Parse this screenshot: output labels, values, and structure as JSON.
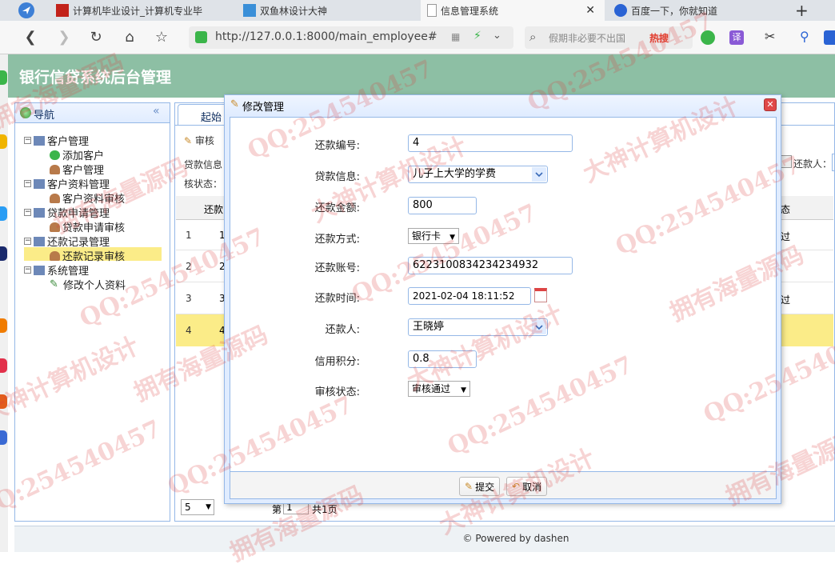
{
  "browser": {
    "tabs": [
      {
        "title": "计算机毕业设计_计算机专业毕"
      },
      {
        "title": "双鱼林设计大神"
      },
      {
        "title": "信息管理系统"
      },
      {
        "title": "百度一下，你就知道"
      }
    ],
    "url": "http://127.0.0.1:8000/main_employee#",
    "search_placeholder": "假期非必要不出国",
    "hot_label": "热搜",
    "translate_label": "译"
  },
  "app": {
    "title": "银行信贷系统后台管理",
    "nav_title": "导航",
    "tree": [
      {
        "label": "客户管理",
        "level": 0
      },
      {
        "label": "添加客户",
        "level": 1
      },
      {
        "label": "客户管理",
        "level": 1
      },
      {
        "label": "客户资料管理",
        "level": 0
      },
      {
        "label": "客户资料审核",
        "level": 1
      },
      {
        "label": "贷款申请管理",
        "level": 0
      },
      {
        "label": "贷款申请审核",
        "level": 1
      },
      {
        "label": "还款记录管理",
        "level": 0
      },
      {
        "label": "还款记录审核",
        "level": 1
      },
      {
        "label": "系统管理",
        "level": 0
      },
      {
        "label": "修改个人资料",
        "level": 1
      }
    ],
    "main": {
      "tab_label": "起始",
      "toolbar_review": "审核",
      "filter_loan_info": "贷款信息",
      "filter_status": "核状态：",
      "filter_payer": "还款人：",
      "col_header": "还款",
      "col_status": "态",
      "rows": [
        "1",
        "2",
        "3",
        "4"
      ],
      "row_ids": [
        "1",
        "2",
        "3",
        "4"
      ],
      "row_status": [
        "过",
        "",
        "过",
        ""
      ],
      "page_size": "5",
      "page_label": "第",
      "page_value": "1",
      "page_total": "共1页"
    },
    "footer": "© Powered by dashen"
  },
  "modal": {
    "title": "修改管理",
    "fields": {
      "id_label": "还款编号:",
      "id_value": "4",
      "loan_label": "贷款信息:",
      "loan_value": "儿子上大学的学费",
      "amount_label": "还款金额:",
      "amount_value": "800",
      "method_label": "还款方式:",
      "method_value": "银行卡",
      "account_label": "还款账号:",
      "account_value": "6223100834234234932",
      "time_label": "还款时间:",
      "time_value": "2021-02-04 18:11:52",
      "payer_label": "还款人:",
      "payer_value": "王晓婷",
      "credit_label": "信用积分:",
      "credit_value": "0.8",
      "status_label": "审核状态:",
      "status_value": "审核通过"
    },
    "submit_label": "提交",
    "cancel_label": "取消"
  },
  "watermarks": [
    "QQ:254540457",
    "拥有海量源码",
    "大神计算机设计"
  ]
}
